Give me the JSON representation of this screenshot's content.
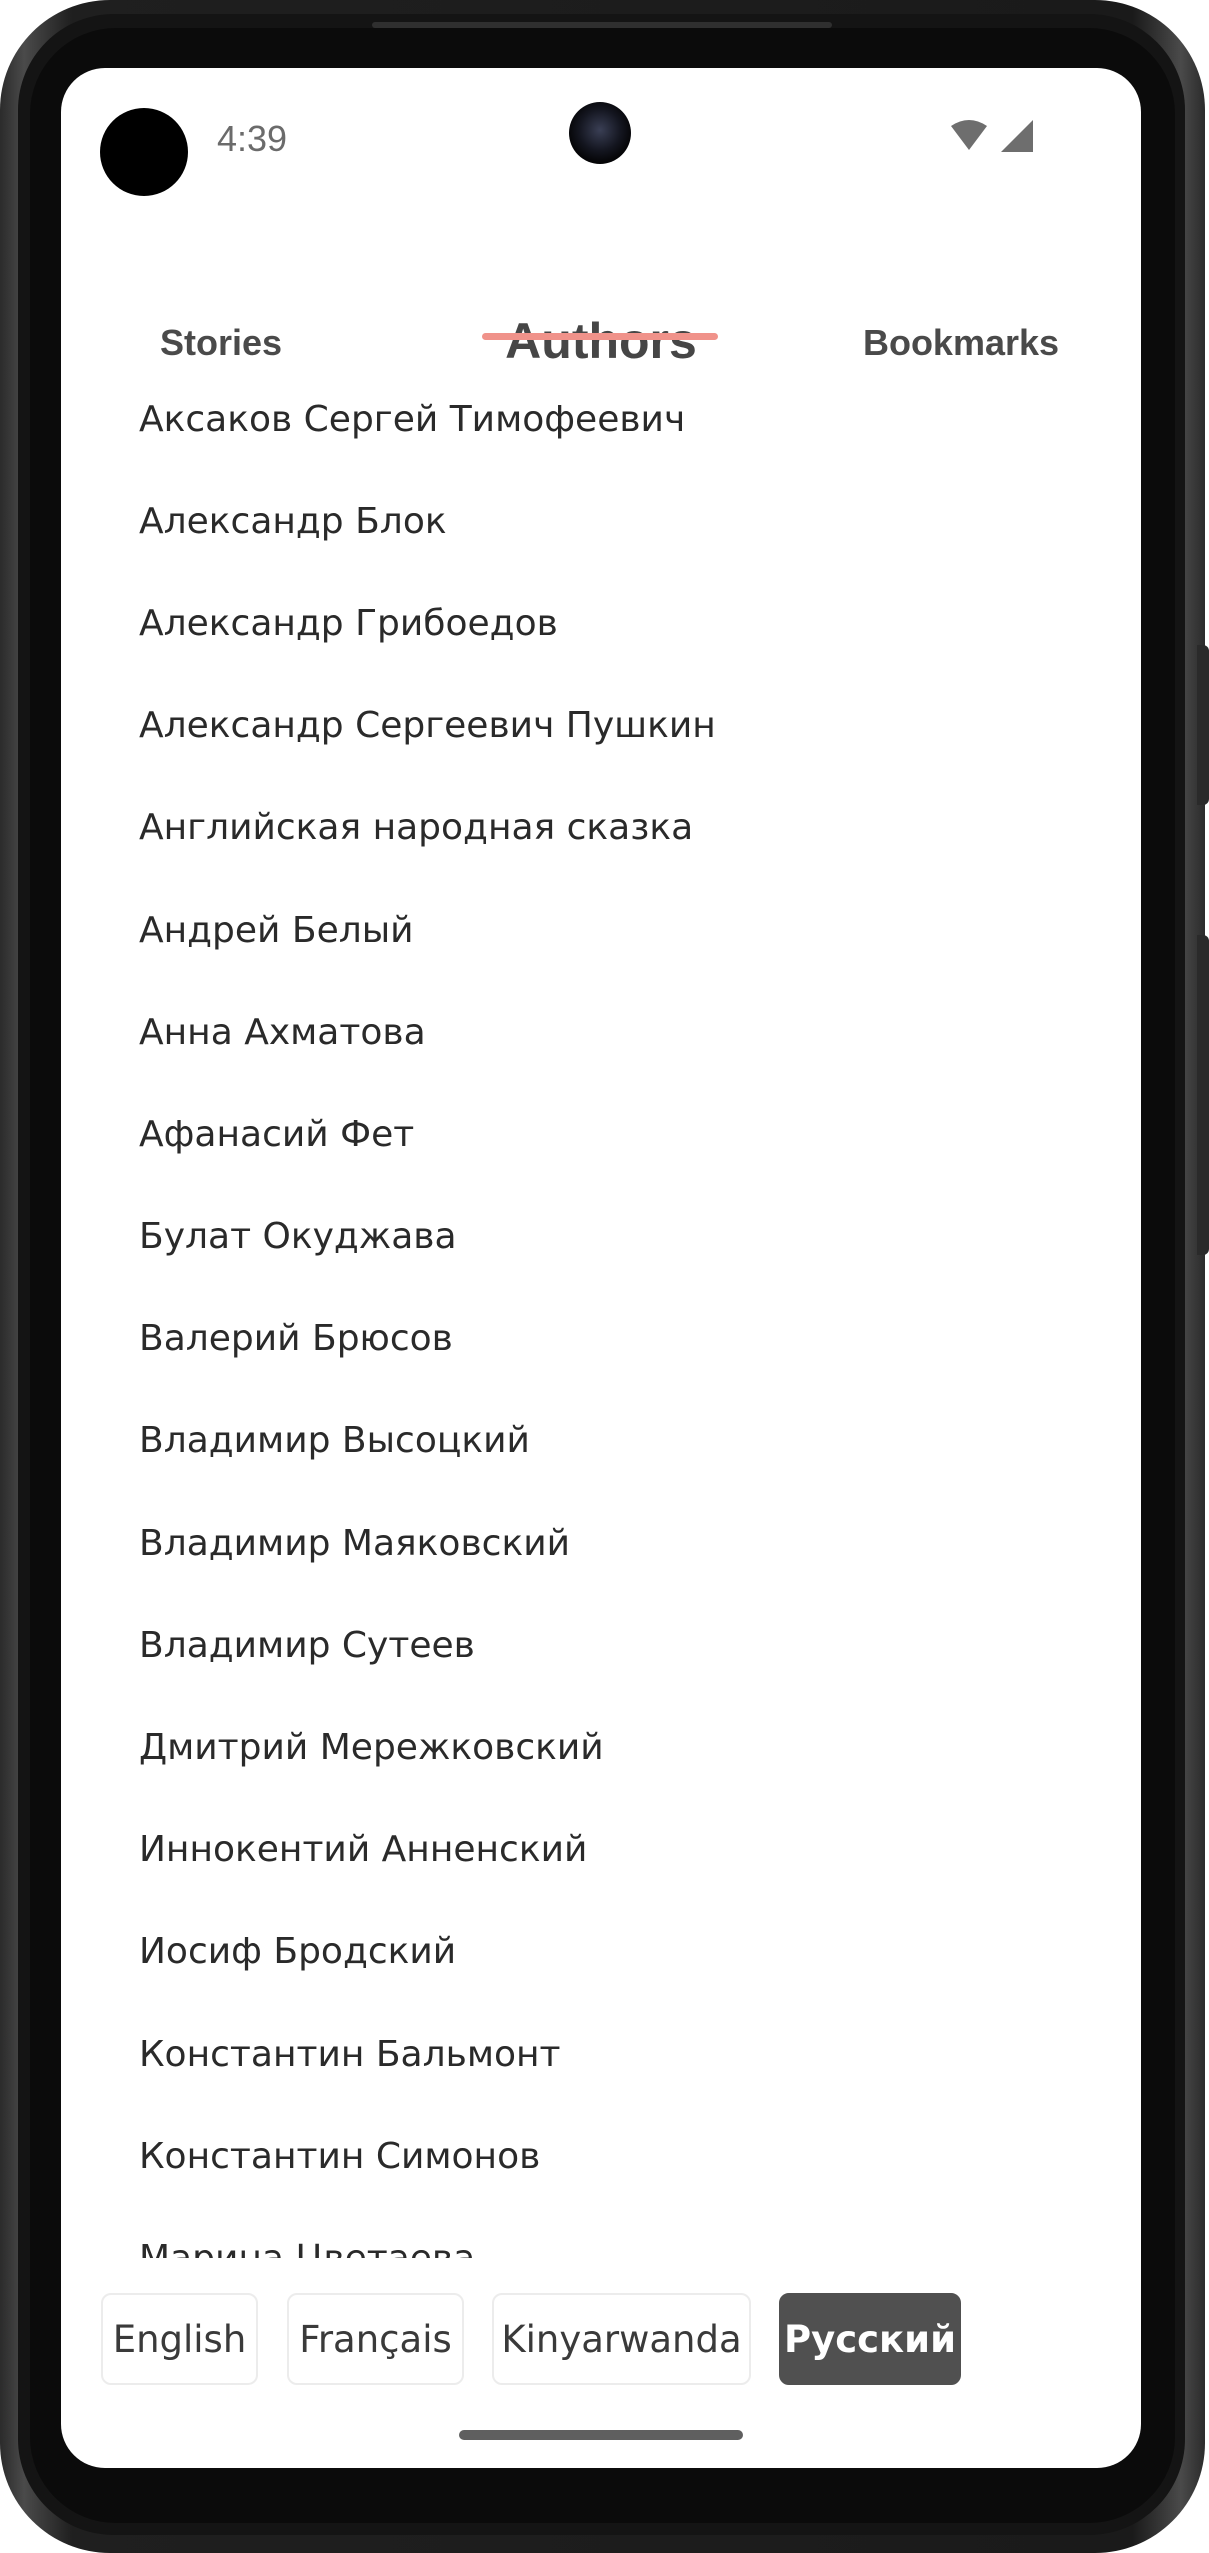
{
  "status_bar": {
    "time": "4:39",
    "icons": [
      "wifi-icon",
      "cellular-signal-icon"
    ]
  },
  "tabs": [
    {
      "label": "Stories",
      "selected": false
    },
    {
      "label": "Authors",
      "selected": true
    },
    {
      "label": "Bookmarks",
      "selected": false
    }
  ],
  "authors": [
    "Аксаков Сергей Тимофеевич",
    "Александр Блок",
    "Александр Грибоедов",
    "Александр Сергеевич Пушкин",
    "Английская народная сказка",
    "Андрей Белый",
    "Анна Ахматова",
    "Афанасий Фет",
    "Булат Окуджава",
    "Валерий Брюсов",
    "Владимир Высоцкий",
    "Владимир Маяковский",
    "Владимир Сутеев",
    "Дмитрий Мережковский",
    "Иннокентий Анненский",
    "Иосиф Бродский",
    "Константин Бальмонт",
    "Константин Симонов",
    "Марина Цветаева"
  ],
  "languages": [
    {
      "label": "English",
      "selected": false
    },
    {
      "label": "Français",
      "selected": false
    },
    {
      "label": "Kinyarwanda",
      "selected": false
    },
    {
      "label": "Русский",
      "selected": true
    }
  ],
  "colors": {
    "tab_indicator": "#f0928a",
    "active_language_bg": "#505050",
    "text": "#2a2a2a"
  }
}
